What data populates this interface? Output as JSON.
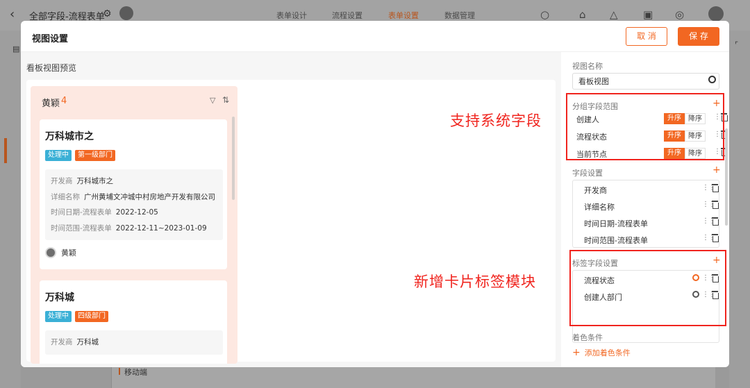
{
  "app": {
    "back_icon": "chevron-left-icon",
    "title": "全部字段-流程表单",
    "tabs": [
      {
        "label": "表单设计"
      },
      {
        "label": "流程设置"
      },
      {
        "label": "表单设置",
        "active": true
      },
      {
        "label": "数据管理"
      }
    ],
    "right_icons": [
      "search-icon",
      "home-icon",
      "shirt-icon",
      "download-icon",
      "settings-icon"
    ],
    "bottom_text": "移动端"
  },
  "modal": {
    "title": "视图设置",
    "cancel_label": "取 消",
    "save_label": "保 存",
    "accent_color": "#f26722"
  },
  "preview": {
    "title": "看板视图预览",
    "column": {
      "title": "黄颖",
      "count": "4",
      "cards": [
        {
          "title": "万科城市之",
          "tags": [
            {
              "text": "处理中",
              "color": "#3ab0d6"
            },
            {
              "text": "第一级部门",
              "color": "#f26722"
            }
          ],
          "fields": [
            {
              "label": "开发商",
              "value": "万科城市之"
            },
            {
              "label": "详细名称",
              "value": "广州黄埔文冲城中村房地产开发有限公司"
            },
            {
              "label": "时间日期-流程表单",
              "value": "2022-12-05"
            },
            {
              "label": "时间范围-流程表单",
              "value": "2022-12-11~2023-01-09"
            }
          ],
          "user": "黄颖"
        },
        {
          "title": "万科城",
          "tags": [
            {
              "text": "处理中",
              "color": "#3ab0d6"
            },
            {
              "text": "四级部门",
              "color": "#f26722"
            }
          ],
          "fields": [
            {
              "label": "开发商",
              "value": "万科城"
            }
          ]
        }
      ]
    }
  },
  "annotations": {
    "system_fields": "支持系统字段",
    "card_tags": "新增卡片标签模块"
  },
  "settings": {
    "view_name_label": "视图名称",
    "view_name_value": "看板视图",
    "group_range": {
      "label": "分组字段范围",
      "asc_label": "升序",
      "desc_label": "降序",
      "items": [
        {
          "label": "创建人"
        },
        {
          "label": "流程状态"
        },
        {
          "label": "当前节点"
        }
      ]
    },
    "field_settings": {
      "label": "字段设置",
      "items": [
        {
          "label": "开发商"
        },
        {
          "label": "详细名称"
        },
        {
          "label": "时间日期-流程表单"
        },
        {
          "label": "时间范围-流程表单"
        }
      ]
    },
    "tag_fields": {
      "label": "标签字段设置",
      "items": [
        {
          "label": "流程状态",
          "palette_color": "#f26722"
        },
        {
          "label": "创建人部门",
          "palette_color": "#555555"
        }
      ]
    },
    "color_conditions": {
      "label": "着色条件",
      "add_label": "添加着色条件"
    }
  }
}
